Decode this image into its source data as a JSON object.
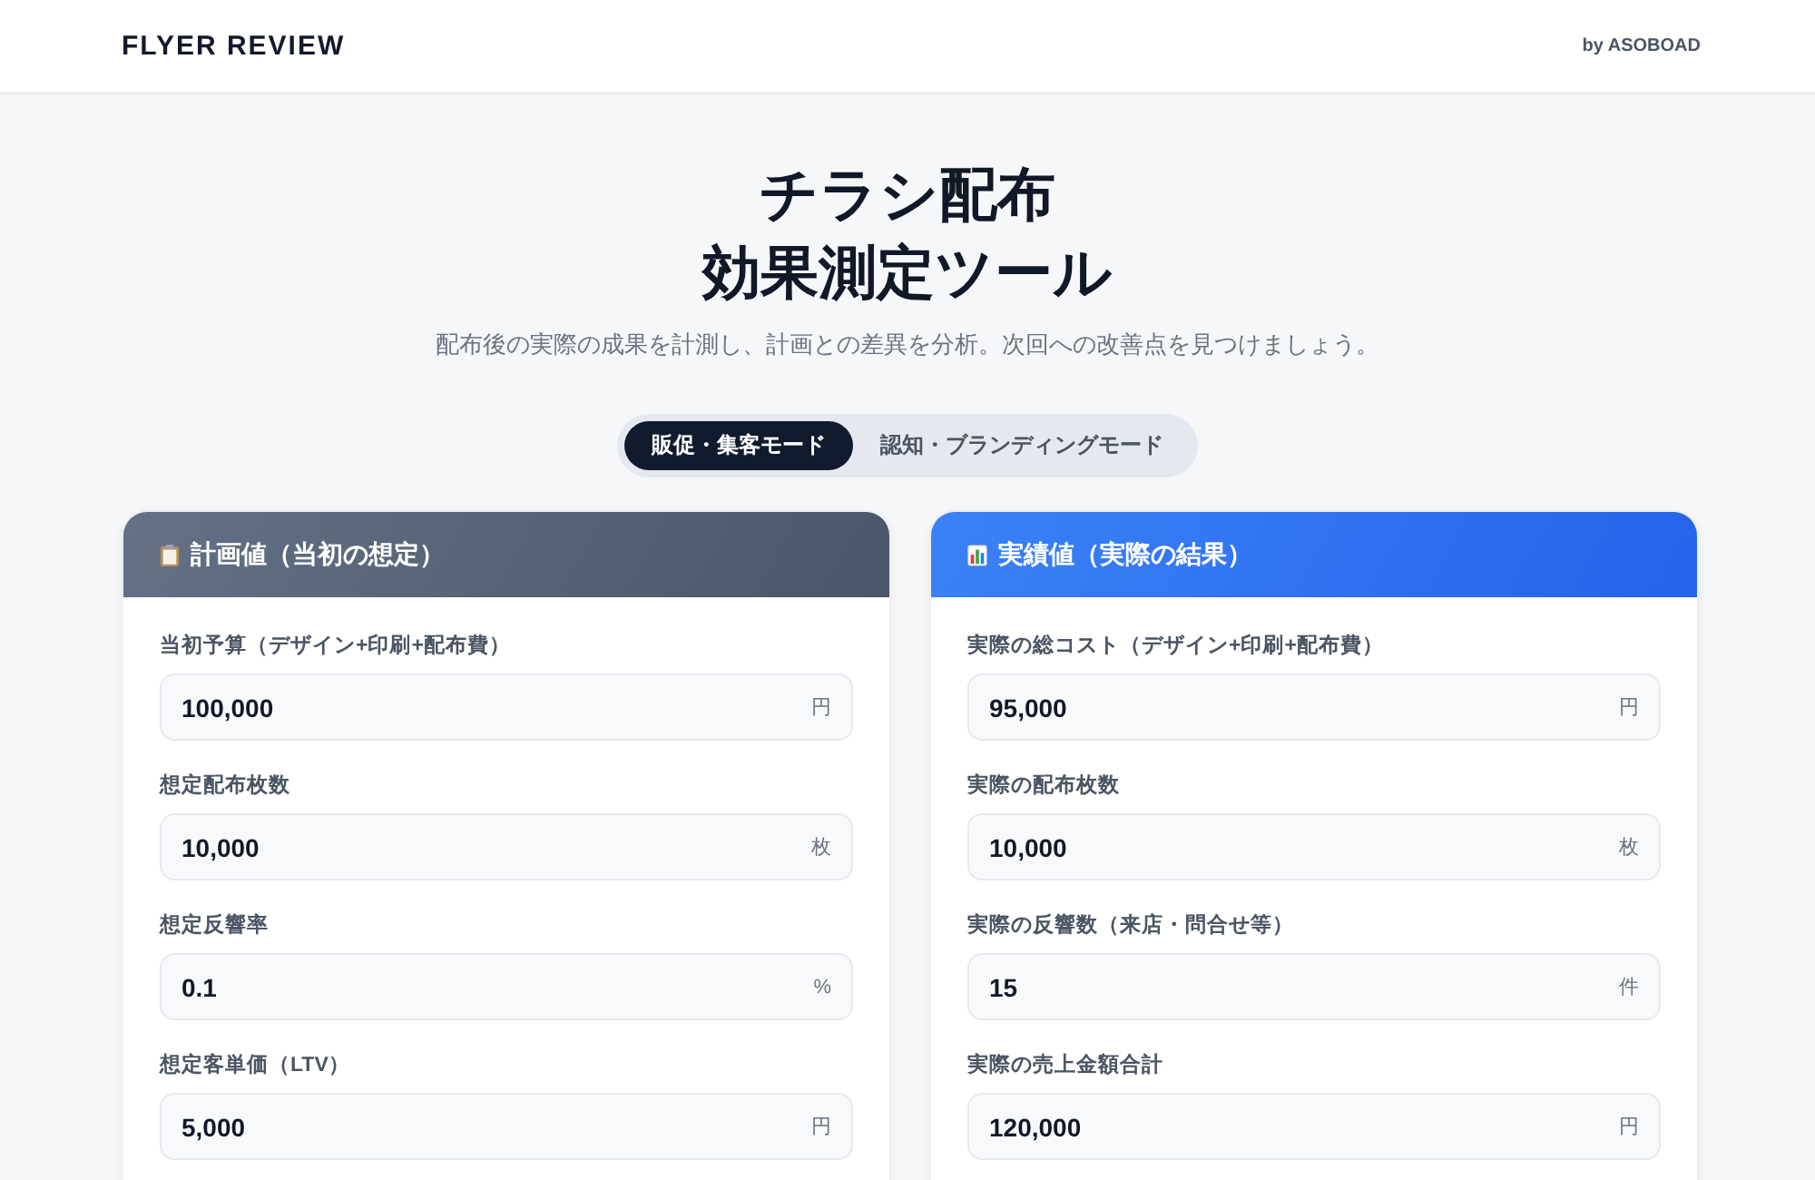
{
  "header": {
    "logo": "FLYER REVIEW",
    "byline": "by ASOBOAD"
  },
  "hero": {
    "title_lines": [
      "チラシ配布",
      "効果測定ツール"
    ],
    "subtitle": "配布後の実際の成果を計測し、計画との差異を分析。次回への改善点を見つけましょう。"
  },
  "mode_tabs": [
    {
      "label": "販促・集客モード",
      "selected": true
    },
    {
      "label": "認知・ブランディングモード",
      "selected": false
    }
  ],
  "panels": [
    {
      "kind": "plan",
      "title": "計画値（当初の想定）",
      "fields": [
        {
          "label": "当初予算（デザイン+印刷+配布費）",
          "value": "100,000",
          "unit": "円"
        },
        {
          "label": "想定配布枚数",
          "value": "10,000",
          "unit": "枚"
        },
        {
          "label": "想定反響率",
          "value": "0.1",
          "unit": "%"
        },
        {
          "label": "想定客単価（LTV）",
          "value": "5,000",
          "unit": "円"
        }
      ]
    },
    {
      "kind": "actual",
      "title": "実績値（実際の結果）",
      "fields": [
        {
          "label": "実際の総コスト（デザイン+印刷+配布費）",
          "value": "95,000",
          "unit": "円"
        },
        {
          "label": "実際の配布枚数",
          "value": "10,000",
          "unit": "枚"
        },
        {
          "label": "実際の反響数（来店・問合せ等）",
          "value": "15",
          "unit": "件"
        },
        {
          "label": "実際の売上金額合計",
          "value": "120,000",
          "unit": "円"
        }
      ]
    }
  ]
}
